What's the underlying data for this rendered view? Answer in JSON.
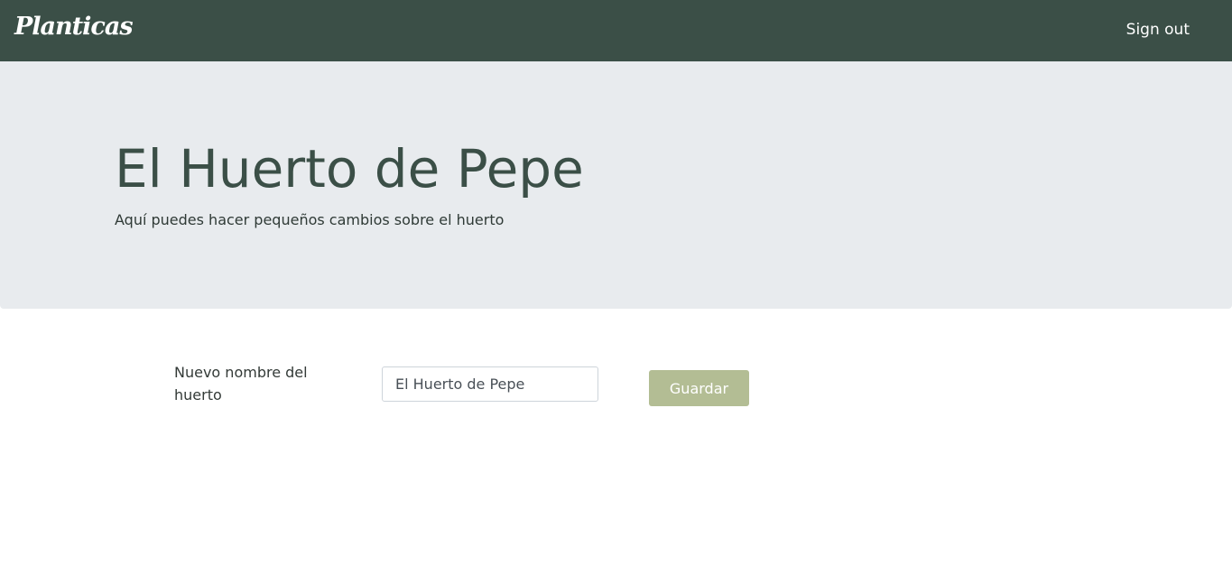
{
  "navbar": {
    "brand": "Planticas",
    "signout_label": "Sign out"
  },
  "hero": {
    "title": "El Huerto de Pepe",
    "subtitle": "Aquí puedes hacer pequeños cambios sobre el huerto"
  },
  "form": {
    "label": "Nuevo nombre del huerto",
    "input_value": "El Huerto de Pepe",
    "save_label": "Guardar"
  },
  "colors": {
    "navbar_bg": "#3b4f47",
    "jumbotron_bg": "#e8ebee",
    "button_bg": "#b3bd94"
  }
}
